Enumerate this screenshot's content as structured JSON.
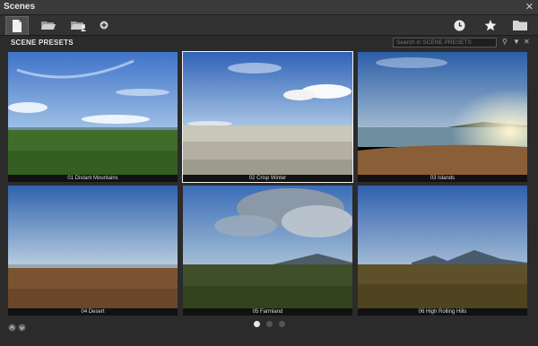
{
  "window": {
    "title": "Scenes",
    "close_glyph": "✕"
  },
  "toolbar": {
    "left_buttons": [
      {
        "name": "new-scene-icon"
      },
      {
        "name": "open-folder-icon"
      },
      {
        "name": "folder-user-icon"
      },
      {
        "name": "add-circle-icon"
      }
    ],
    "right_buttons": [
      {
        "name": "history-clock-icon"
      },
      {
        "name": "favorites-star-icon"
      },
      {
        "name": "folder-icon"
      }
    ]
  },
  "section": {
    "label": "SCENE PRESETS"
  },
  "search": {
    "placeholder": "Search in SCENE PRESETS"
  },
  "presets": [
    {
      "label": "01 Distant Mountains"
    },
    {
      "label": "02 Crisp Winter"
    },
    {
      "label": "03 Islands"
    },
    {
      "label": "04 Desert"
    },
    {
      "label": "05 Farmland"
    },
    {
      "label": "06 High Rolling Hills"
    }
  ],
  "pagination": {
    "pages": 3,
    "current": 1
  }
}
